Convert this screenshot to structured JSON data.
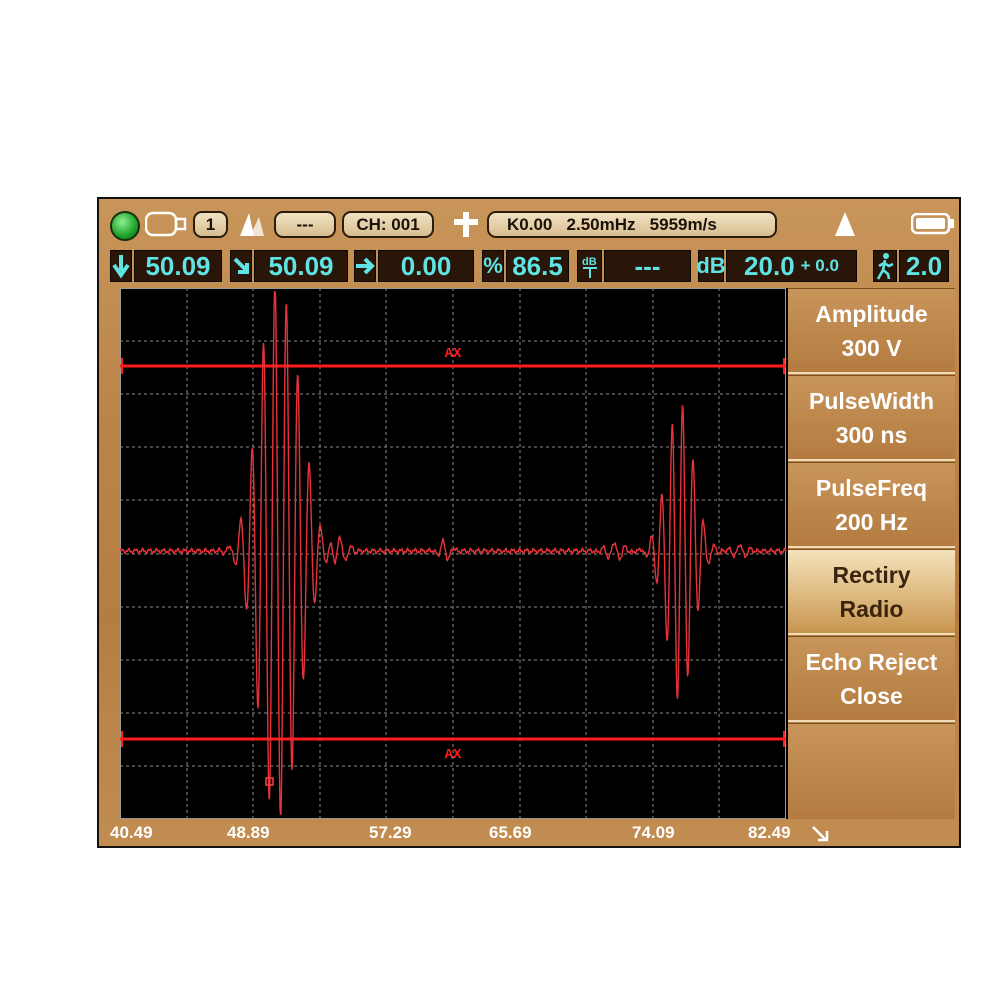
{
  "status_bar": {
    "channel_index": "1",
    "gate_mode": "---",
    "channel": "CH: 001",
    "probe_info": "K0.00   2.50mHz   5959m/s"
  },
  "readouts": {
    "depth": "50.09",
    "path": "50.09",
    "surface": "0.00",
    "amplitude_pct": "86.5",
    "db_diff": "---",
    "gain_db": "20.0",
    "gain_offset": "+ 0.0",
    "step": "2.0"
  },
  "scope": {
    "gate_a_label": "AX",
    "gate_b_label": "AX",
    "x_ticks": [
      "40.49",
      "48.89",
      "57.29",
      "65.69",
      "74.09",
      "82.49"
    ]
  },
  "menu": [
    {
      "line1": "Amplitude",
      "line2": "300 V"
    },
    {
      "line1": "PulseWidth",
      "line2": "300 ns"
    },
    {
      "line1": "PulseFreq",
      "line2": "200 Hz"
    },
    {
      "line1": "Rectiry",
      "line2": "Radio"
    },
    {
      "line1": "Echo Reject",
      "line2": "Close"
    }
  ],
  "colors": {
    "waveform": "#e8323a",
    "gate": "#ff1c1c",
    "readout_text": "#5fe3e3",
    "panel": "#bb8447"
  }
}
